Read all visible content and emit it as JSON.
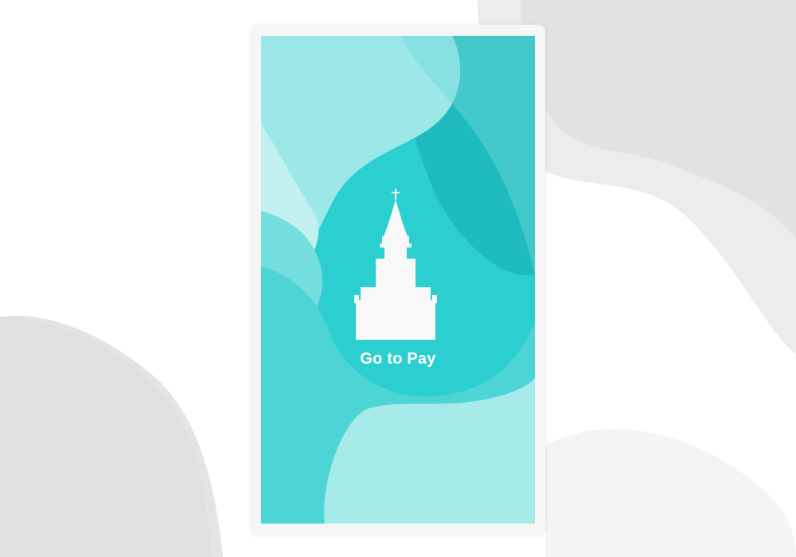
{
  "screen": {
    "call_to_action": "Go to Pay",
    "icon": "church-icon"
  },
  "colors": {
    "page_background": "#ffffff",
    "blob_gray": "#e6e6e6",
    "frame": "#f6f6f6",
    "teal_base": "#2ccfcf",
    "teal_dark": "#1fbcbf",
    "teal_light": "#a6eaea",
    "icon_fill": "#f8f8f8"
  }
}
